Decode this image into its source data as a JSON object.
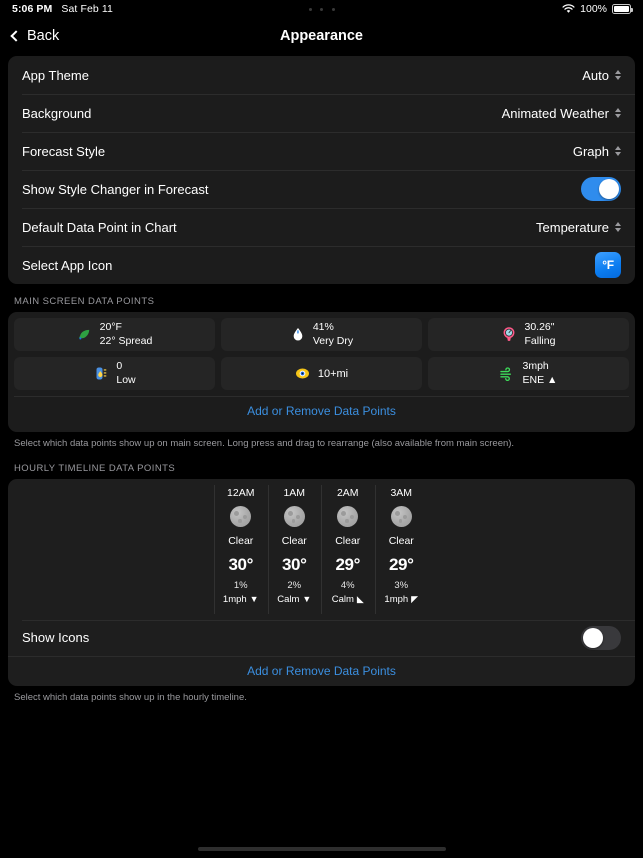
{
  "status_bar": {
    "time": "5:06 PM",
    "date": "Sat Feb 11",
    "battery_percent": "100%",
    "wifi_icon": "wifi-icon",
    "battery_icon": "battery-full-icon",
    "dots_icon": "more-dots-icon"
  },
  "nav": {
    "back_label": "Back",
    "title": "Appearance"
  },
  "settings": {
    "app_theme": {
      "label": "App Theme",
      "value": "Auto"
    },
    "background": {
      "label": "Background",
      "value": "Animated Weather"
    },
    "forecast_style": {
      "label": "Forecast Style",
      "value": "Graph"
    },
    "style_changer": {
      "label": "Show Style Changer in Forecast",
      "enabled": true
    },
    "default_data_point": {
      "label": "Default Data Point in Chart",
      "value": "Temperature"
    },
    "select_app_icon": {
      "label": "Select App Icon",
      "icon_label": "°F"
    }
  },
  "main_screen_section": {
    "header": "MAIN SCREEN DATA POINTS",
    "footer": "Select which data points show up on main screen. Long press and drag to rearrange (also available from main screen).",
    "add_remove_label": "Add or Remove Data Points",
    "tiles": [
      {
        "icon": "dew-point-leaf-icon",
        "line1": "20°F",
        "line2": "22° Spread",
        "color": "#39b54a"
      },
      {
        "icon": "humidity-droplet-icon",
        "line1": "41%",
        "line2": "Very Dry",
        "color": "#ffffff"
      },
      {
        "icon": "pressure-gauge-icon",
        "line1": "30.26\"",
        "line2": "Falling",
        "color": "#ff5a8a"
      },
      {
        "icon": "uv-index-icon",
        "line1": "0",
        "line2": "Low",
        "color": "#4a90e2"
      },
      {
        "icon": "visibility-eye-icon",
        "line1": "10+mi",
        "line2": "",
        "color": "#f5c518"
      },
      {
        "icon": "wind-icon",
        "line1": "3mph",
        "line2": "ENE ▲",
        "color": "#3ddc5a"
      }
    ]
  },
  "hourly_section": {
    "header": "HOURLY TIMELINE DATA POINTS",
    "footer": "Select which data points show up in the hourly timeline.",
    "add_remove_label": "Add or Remove Data Points",
    "show_icons": {
      "label": "Show Icons",
      "enabled": false
    },
    "columns": [
      {
        "time": "12AM",
        "icon": "moon-icon",
        "condition": "Clear",
        "temp": "30°",
        "pop": "1%",
        "wind": "1mph",
        "wind_arrow": "▼"
      },
      {
        "time": "1AM",
        "icon": "moon-icon",
        "condition": "Clear",
        "temp": "30°",
        "pop": "2%",
        "wind": "Calm",
        "wind_arrow": "▼"
      },
      {
        "time": "2AM",
        "icon": "moon-icon",
        "condition": "Clear",
        "temp": "29°",
        "pop": "4%",
        "wind": "Calm",
        "wind_arrow": "◣"
      },
      {
        "time": "3AM",
        "icon": "moon-icon",
        "condition": "Clear",
        "temp": "29°",
        "pop": "3%",
        "wind": "1mph",
        "wind_arrow": "◤"
      }
    ]
  },
  "colors": {
    "accent_blue": "#3b8fe0",
    "toggle_on": "#2f8ced",
    "card_bg": "#1c1c1c",
    "tile_bg": "#252525"
  }
}
